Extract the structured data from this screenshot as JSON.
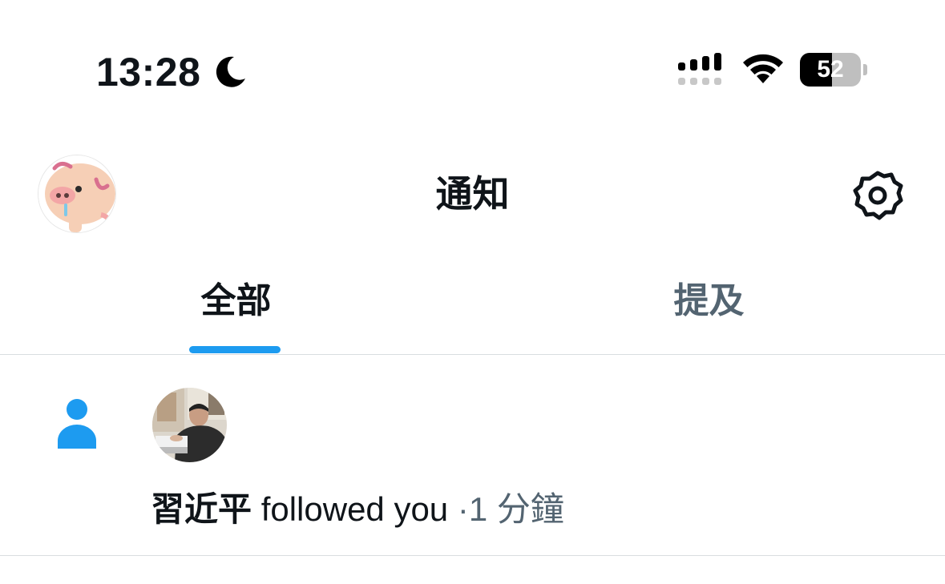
{
  "status_bar": {
    "time": "13:28",
    "focus_icon": "moon-icon",
    "signal_icon": "cellular-signal-icon",
    "wifi_icon": "wifi-icon",
    "battery_level": "52",
    "battery_fraction": 0.52
  },
  "header": {
    "title": "通知",
    "avatar_icon": "pig-avatar",
    "settings_icon": "gear-icon"
  },
  "tabs": [
    {
      "label": "全部",
      "active": true
    },
    {
      "label": "提及",
      "active": false
    }
  ],
  "notifications": [
    {
      "type_icon": "person-icon",
      "name": "習近平",
      "action": "followed you",
      "separator": "·",
      "time": "1 分鐘"
    }
  ],
  "colors": {
    "accent": "#1d9bf0",
    "text_primary": "#0f1419",
    "text_secondary": "#536471",
    "divider": "#d9dde0"
  }
}
